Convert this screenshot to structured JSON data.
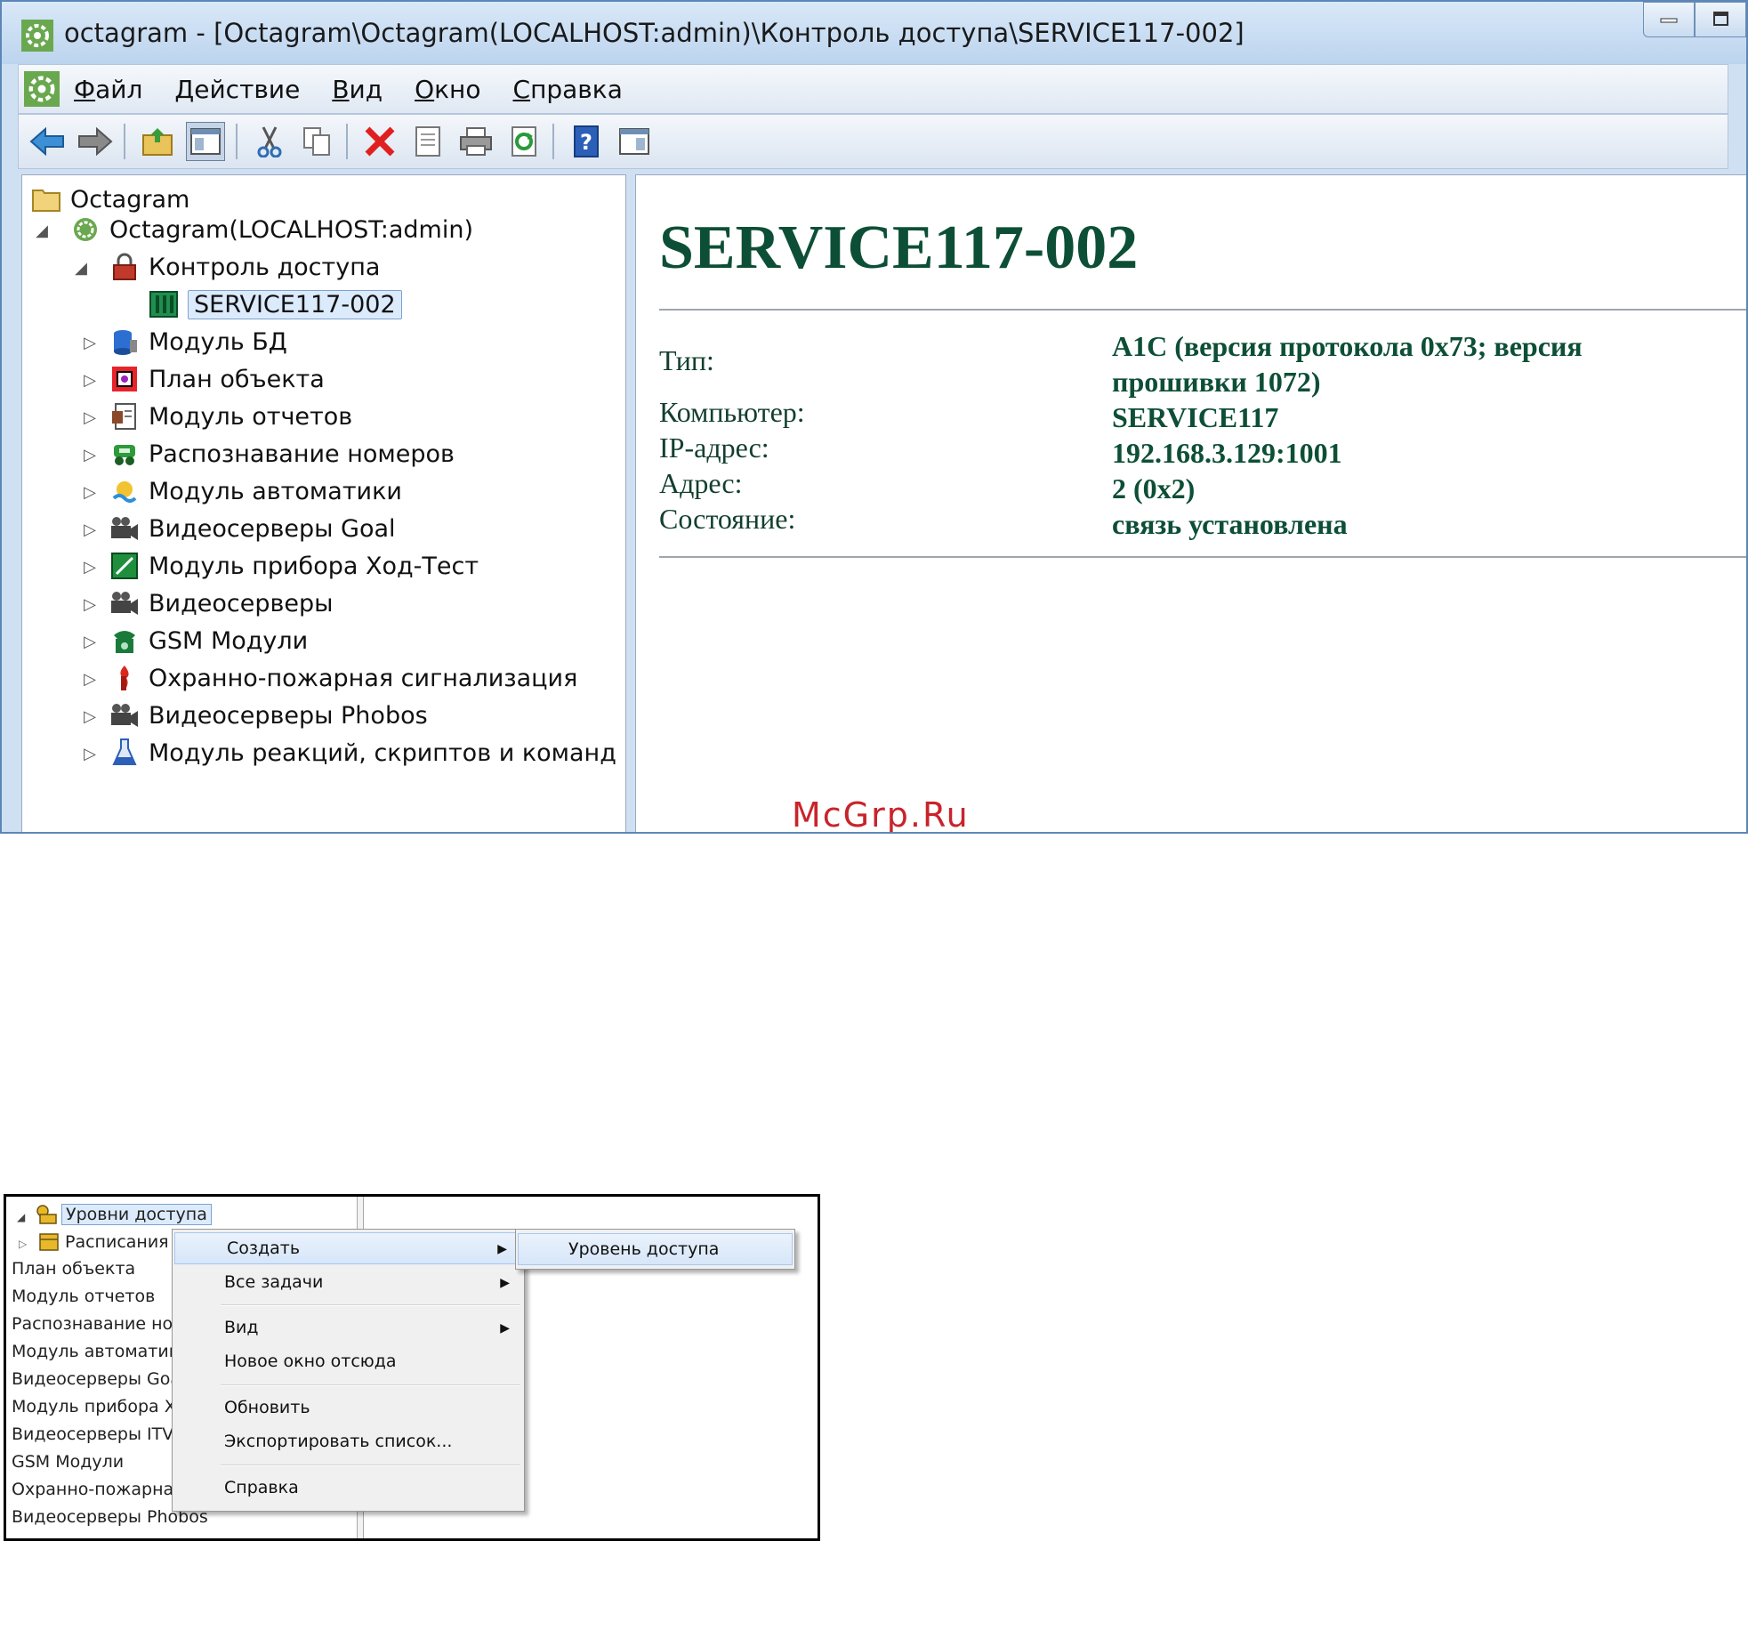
{
  "window": {
    "title": "octagram - [Octagram\\Octagram(LOCALHOST:admin)\\Контроль доступа\\SERVICE117-002]",
    "minimize_icon": "minimize-icon",
    "restore_icon": "restore-icon"
  },
  "menubar": {
    "items": [
      {
        "underline": "Ф",
        "rest": "айл"
      },
      {
        "underline": "Д",
        "rest": "ействие"
      },
      {
        "underline": "В",
        "rest": "ид"
      },
      {
        "underline": "О",
        "rest": "кно"
      },
      {
        "underline": "С",
        "rest": "правка"
      }
    ]
  },
  "toolbar": {
    "buttons": [
      "back-icon",
      "forward-icon",
      "up-folder-icon",
      "show-hide-tree-icon",
      "cut-icon",
      "copy-icon",
      "delete-icon",
      "properties-icon",
      "print-icon",
      "refresh-icon",
      "help-icon",
      "action-pane-icon"
    ]
  },
  "tree": {
    "root": "Octagram",
    "server": "Octagram(LOCALHOST:admin)",
    "access_control": "Контроль доступа",
    "selected": "SERVICE117-002",
    "modules": [
      "Модуль БД",
      "План объекта",
      "Модуль отчетов",
      "Распознавание номеров",
      "Модуль автоматики",
      "Видеосерверы Goal",
      "Модуль прибора Ход-Тест",
      "Видеосерверы",
      "GSM Модули",
      "Охранно-пожарная сигнализация",
      "Видеосерверы Phobos",
      "Модуль реакций, скриптов и команд"
    ]
  },
  "details": {
    "title": "SERVICE117-002",
    "properties": [
      {
        "label": "Тип:",
        "value": "A1C (версия протокола 0x73; версия прошивки 1072)"
      },
      {
        "label": "Компьютер:",
        "value": "SERVICE117"
      },
      {
        "label": "IP-адрес:",
        "value": "192.168.3.129:1001"
      },
      {
        "label": "Адрес:",
        "value": "2 (0x2)"
      },
      {
        "label": "Состояние:",
        "value": "связь установлена"
      }
    ]
  },
  "watermark": "McGrp.Ru",
  "context_screenshot": {
    "tree": {
      "levels": "Уровни доступа",
      "schedules": "Расписания",
      "rows": [
        "План объекта",
        "Модуль отчетов",
        "Распознавание но",
        "Модуль автоматик",
        "Видеосерверы Goa",
        "Модуль прибора Х",
        "Видеосерверы ITV/",
        "GSM Модули",
        "Охранно-пожарна",
        "Видеосерверы Phobos"
      ]
    },
    "menu": {
      "create": "Создать",
      "all_tasks": "Все задачи",
      "view": "Вид",
      "new_window": "Новое окно отсюда",
      "refresh": "Обновить",
      "export": "Экспортировать список...",
      "help": "Справка"
    },
    "submenu": {
      "access_level": "Уровень доступа"
    }
  }
}
